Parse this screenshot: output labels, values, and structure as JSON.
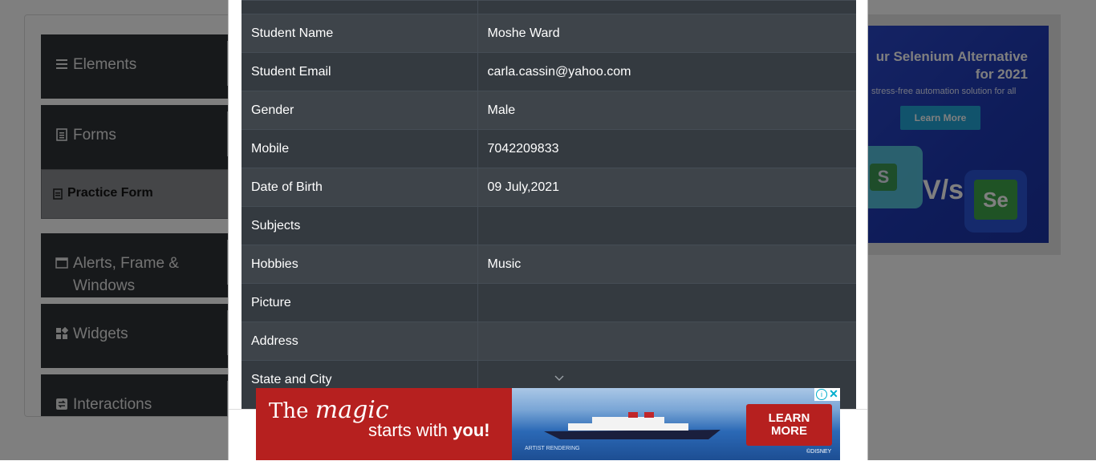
{
  "sidebar": {
    "groups": [
      {
        "label": "Elements",
        "icon": "menu-icon"
      },
      {
        "label": "Forms",
        "icon": "document-icon"
      },
      {
        "label": "Alerts, Frame &",
        "label2": "Windows",
        "icon": "window-icon"
      },
      {
        "label": "Widgets",
        "icon": "widgets-icon"
      },
      {
        "label": "Interactions",
        "icon": "interactions-icon"
      }
    ],
    "active_item": "Practice Form"
  },
  "ad_right": {
    "headline": "ur Selenium Alternative for 2021",
    "sub": "stress-free automation solution for all",
    "button": "Learn More",
    "vs": "V/s",
    "tile_left": "S",
    "tile_right": "Se"
  },
  "results": {
    "rows": [
      {
        "label": "Student Name",
        "value": "Moshe Ward"
      },
      {
        "label": "Student Email",
        "value": "carla.cassin@yahoo.com"
      },
      {
        "label": "Gender",
        "value": "Male"
      },
      {
        "label": "Mobile",
        "value": "7042209833"
      },
      {
        "label": "Date of Birth",
        "value": "09 July,2021"
      },
      {
        "label": "Subjects",
        "value": ""
      },
      {
        "label": "Hobbies",
        "value": "Music"
      },
      {
        "label": "Picture",
        "value": ""
      },
      {
        "label": "Address",
        "value": ""
      },
      {
        "label": "State and City",
        "value": ""
      }
    ]
  },
  "ad_bottom": {
    "line1_a": "The ",
    "line1_magic": "magic",
    "line2_a": "starts with ",
    "line2_b": "you!",
    "cta_line1": "LEARN",
    "cta_line2": "MORE",
    "fine_print": "ARTIST RENDERING",
    "brand": "©DISNEY",
    "info": "i",
    "close": "✕"
  }
}
